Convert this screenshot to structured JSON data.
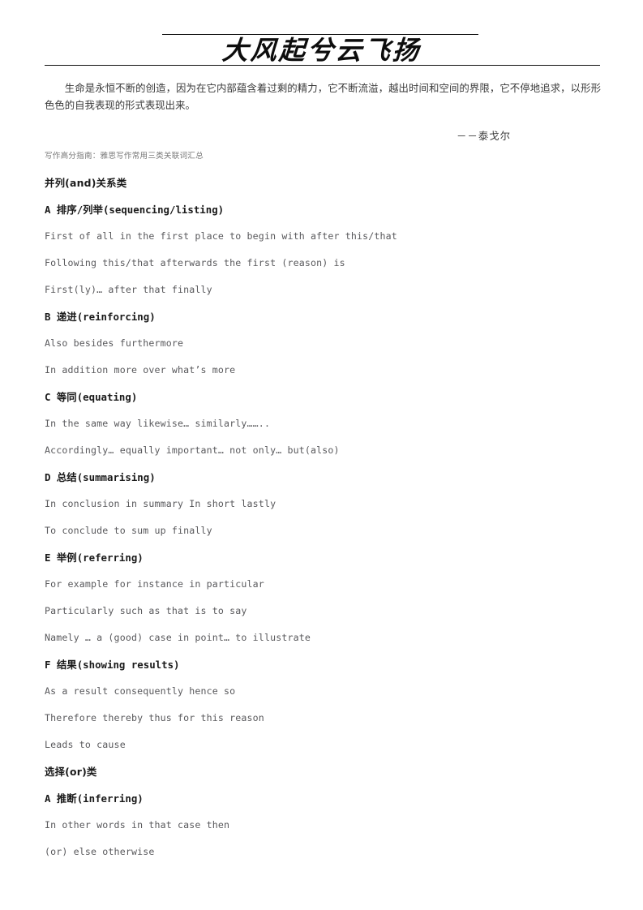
{
  "document": {
    "masthead_title": "大风起兮云飞扬",
    "epigraph": "生命是永恒不断的创造，因为在它内部蕴含着过剩的精力，它不断流溢，越出时间和空间的界限，它不停地追求，以形形色色的自我表现的形式表现出来。",
    "attribution": "－－泰戈尔",
    "subnote": "写作高分指南：雅思写作常用三类关联词汇总"
  },
  "colors": {
    "page_background": "#ffffff",
    "rule": "#111111",
    "heading_text": "#1a1a1a",
    "body_text": "#59595c",
    "subnote_text": "#777777",
    "epigraph_text": "#3a3a3a"
  },
  "sections": [
    {
      "title": "并列(and)关系类",
      "groups": [
        {
          "heading": "A 排序/列举(sequencing/listing)",
          "lines": [
            "First of all in the first place to begin with after this/that",
            "Following this/that afterwards the first (reason) is",
            "First(ly)… after that finally"
          ]
        },
        {
          "heading": "B 递进(reinforcing)",
          "lines": [
            "Also besides furthermore",
            "In addition more over what’s more"
          ]
        },
        {
          "heading": "C 等同(equating)",
          "lines": [
            "In the same way likewise… similarly……..",
            "Accordingly… equally important… not only… but(also)"
          ]
        },
        {
          "heading": "D 总结(summarising)",
          "lines": [
            "In conclusion in summary In short lastly",
            "To conclude to sum up finally"
          ]
        },
        {
          "heading": "E 举例(referring)",
          "lines": [
            "For example for instance in particular",
            "Particularly such as that is to say",
            "Namely … a (good) case in point… to illustrate"
          ]
        },
        {
          "heading": "F 结果(showing results)",
          "lines": [
            "As a result consequently hence so",
            "Therefore thereby thus for this reason",
            "Leads to cause"
          ]
        }
      ]
    },
    {
      "title": "选择(or)类",
      "groups": [
        {
          "heading": "A 推断(inferring)",
          "lines": [
            "In other words in that case then",
            "(or) else otherwise"
          ]
        }
      ]
    }
  ]
}
